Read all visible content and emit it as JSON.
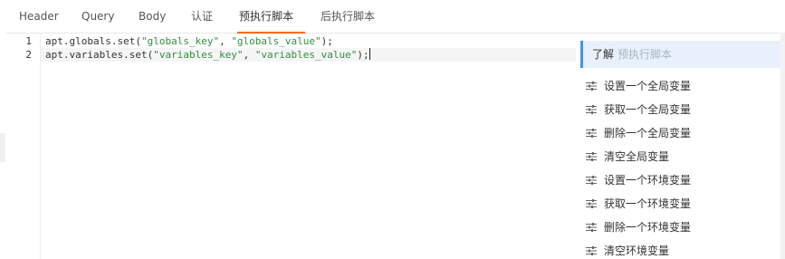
{
  "tabs": [
    {
      "label": "Header"
    },
    {
      "label": "Query"
    },
    {
      "label": "Body"
    },
    {
      "label": "认证"
    },
    {
      "label": "预执行脚本"
    },
    {
      "label": "后执行脚本"
    }
  ],
  "active_tab": "预执行脚本",
  "editor": {
    "lines": [
      {
        "number": "1",
        "prefix": "apt.globals.set(",
        "arg1": "\"globals_key\"",
        "sep": ", ",
        "arg2": "\"globals_value\"",
        "suffix": ");"
      },
      {
        "number": "2",
        "prefix": "apt.variables.set(",
        "arg1": "\"variables_key\"",
        "sep": ", ",
        "arg2": "\"variables_value\"",
        "suffix": ");"
      }
    ]
  },
  "side_panel": {
    "help_label": "了解",
    "help_sub": "预执行脚本",
    "snippets": [
      {
        "label": "设置一个全局变量"
      },
      {
        "label": "获取一个全局变量"
      },
      {
        "label": "删除一个全局变量"
      },
      {
        "label": "清空全局变量"
      },
      {
        "label": "设置一个环境变量"
      },
      {
        "label": "获取一个环境变量"
      },
      {
        "label": "删除一个环境变量"
      },
      {
        "label": "清空环境变量"
      }
    ]
  },
  "colors": {
    "accent": "#ff6907",
    "string": "#2f8f3f",
    "help_bg": "#e8f1fb",
    "help_border": "#4a90e2"
  },
  "icons": {
    "snippet": "sliders-icon"
  }
}
